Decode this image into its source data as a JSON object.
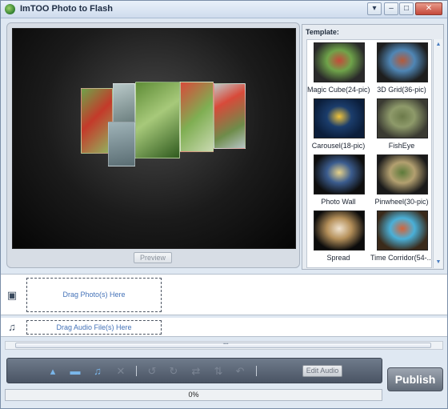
{
  "window": {
    "title": "ImTOO Photo to Flash",
    "controls": [
      "▾",
      "–",
      "□",
      "✕"
    ]
  },
  "preview": {
    "button_label": "Preview"
  },
  "templates": {
    "label": "Template:",
    "items": [
      {
        "name": "Magic Cube(24-pic)",
        "colors": [
          "#2a2a2a",
          "#c44a3a",
          "#6fa34a"
        ]
      },
      {
        "name": "3D Grid(36-pic)",
        "colors": [
          "#1e1e1e",
          "#b45a3a",
          "#4f86b5"
        ]
      },
      {
        "name": "Carousel(18-pic)",
        "colors": [
          "#0b1e3b",
          "#f2c53a",
          "#1b3d6c"
        ]
      },
      {
        "name": "FishEye",
        "colors": [
          "#3a3a32",
          "#6c7a4a",
          "#8e9a6a"
        ]
      },
      {
        "name": "Photo Wall",
        "colors": [
          "#0e0e0e",
          "#e6d28a",
          "#3b5c8e"
        ]
      },
      {
        "name": "Pinwheel(30-pic)",
        "colors": [
          "#1a1a1a",
          "#5c7a3a",
          "#b3a070"
        ]
      },
      {
        "name": "Spread",
        "colors": [
          "#0c0c0c",
          "#f0e3d0",
          "#b5905a"
        ]
      },
      {
        "name": "Time Corridor(54-...",
        "colors": [
          "#3a2a1a",
          "#d4643a",
          "#4ab0d8"
        ]
      }
    ]
  },
  "timeline": {
    "photo_drop": "Drag Photo(s) Here",
    "audio_drop": "Drag Audio File(s) Here"
  },
  "toolbar": {
    "tools": [
      {
        "name": "add-photo-icon",
        "glyph": "▴",
        "enabled": true
      },
      {
        "name": "add-folder-icon",
        "glyph": "▬",
        "enabled": true
      },
      {
        "name": "add-audio-icon",
        "glyph": "♫",
        "enabled": true
      },
      {
        "name": "delete-icon",
        "glyph": "✕",
        "enabled": false
      },
      {
        "name": "rotate-left-icon",
        "glyph": "↺",
        "enabled": false
      },
      {
        "name": "rotate-right-icon",
        "glyph": "↻",
        "enabled": false
      },
      {
        "name": "swap-horizontal-icon",
        "glyph": "⇄",
        "enabled": false
      },
      {
        "name": "swap-vertical-icon",
        "glyph": "⇅",
        "enabled": false
      },
      {
        "name": "undo-icon",
        "glyph": "↶",
        "enabled": false
      }
    ],
    "edit_audio_label": "Edit Audio"
  },
  "publish": {
    "label": "Publish"
  },
  "progress": {
    "value": 0,
    "label": "0%"
  }
}
